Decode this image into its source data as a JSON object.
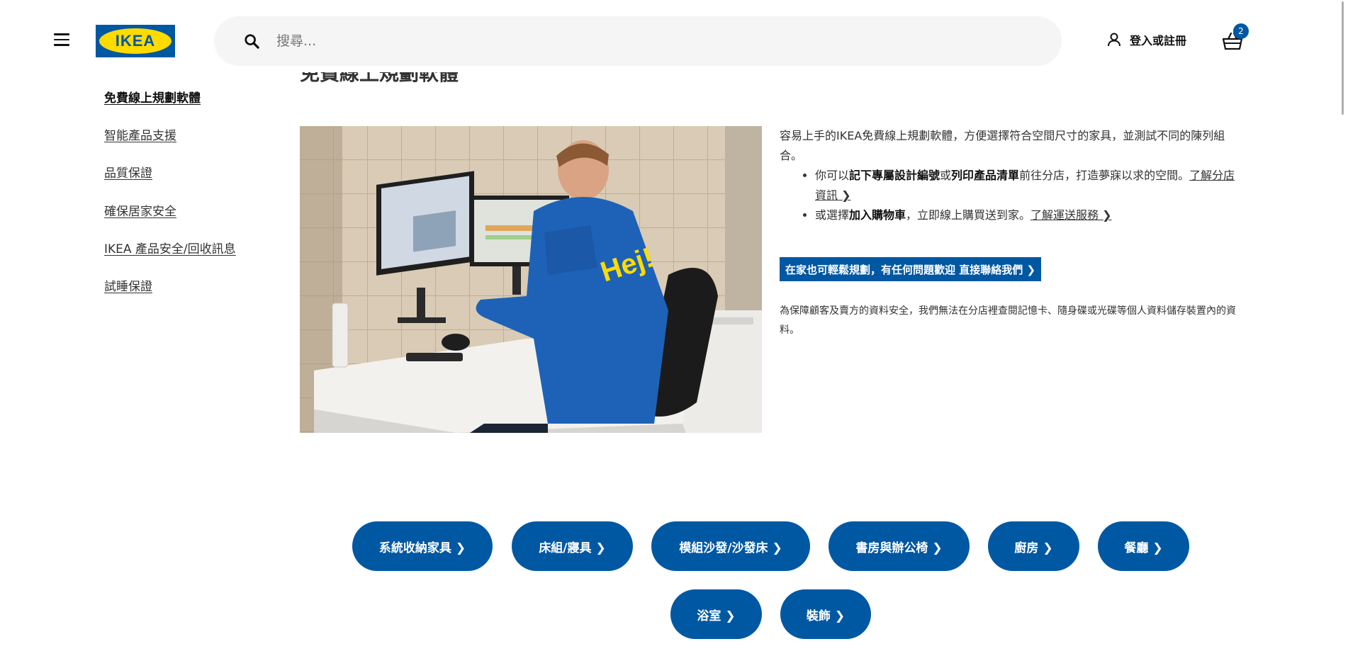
{
  "header": {
    "logo_text": "IKEA",
    "search_placeholder": "搜尋...",
    "login_label": "登入或註冊",
    "cart_count": "2"
  },
  "partial_heading": "免費線上規劃軟體",
  "sidebar": {
    "items": [
      {
        "label": "免費線上規劃軟體",
        "active": true
      },
      {
        "label": "智能產品支援"
      },
      {
        "label": "品質保證"
      },
      {
        "label": "確保居家安全"
      },
      {
        "label": "IKEA 產品安全/回收訊息"
      },
      {
        "label": "試睡保證"
      }
    ]
  },
  "content": {
    "intro": "容易上手的IKEA免費線上規劃軟體，方便選擇符合空間尺寸的家具，並測試不同的陳列組合。",
    "bullet1": {
      "t1": "你可以",
      "b1": "記下專屬設計編號",
      "t2": "或",
      "b2": "列印產品清單",
      "t3": "前往分店，打造夢寐以求的空間。",
      "link": "了解分店資訊 ❯"
    },
    "bullet2": {
      "t1": "或選擇",
      "b1": "加入購物車",
      "t2": "，立即線上購買送到家。",
      "link": "了解運送服務 ❯"
    },
    "cta_label": "在家也可輕鬆規劃，有任何問題歡迎 直接聯絡我們 ❯",
    "note": "為保障顧客及賣方的資料安全，我們無法在分店裡查閱記憶卡、隨身碟或光碟等個人資料儲存裝置內的資料。"
  },
  "hero_image": {
    "jacket_text": "Hej!"
  },
  "categories": [
    {
      "label": "系統收納家具 ❯"
    },
    {
      "label": "床組/寢具 ❯"
    },
    {
      "label": "模組沙發/沙發床 ❯"
    },
    {
      "label": "書房與辦公椅 ❯"
    },
    {
      "label": "廚房 ❯"
    },
    {
      "label": "餐廳 ❯"
    },
    {
      "label": "浴室 ❯"
    },
    {
      "label": "裝飾 ❯"
    }
  ],
  "colors": {
    "brand_blue": "#0058a3",
    "brand_yellow": "#ffdb00"
  }
}
